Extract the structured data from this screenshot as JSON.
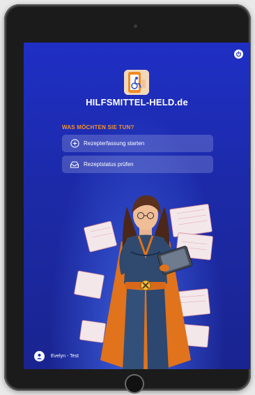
{
  "app": {
    "brand_title": "HILFSMITTEL-HELD.de"
  },
  "icons": {
    "power": "power-icon",
    "logo": "wheelchair-phone-logo",
    "start": "plus-circle-icon",
    "status": "inbox-tray-icon",
    "user": "user-avatar-icon"
  },
  "main": {
    "question": "WAS MÖCHTEN SIE TUN?",
    "actions": [
      {
        "label": "Rezepterfassung starten"
      },
      {
        "label": "Rezeptstatus prüfen"
      }
    ]
  },
  "user": {
    "name": "Evelyn - Test"
  },
  "colors": {
    "accent": "#f5912b",
    "background": "#1f2fc4",
    "button_bg": "rgba(255,255,255,0.18)"
  }
}
